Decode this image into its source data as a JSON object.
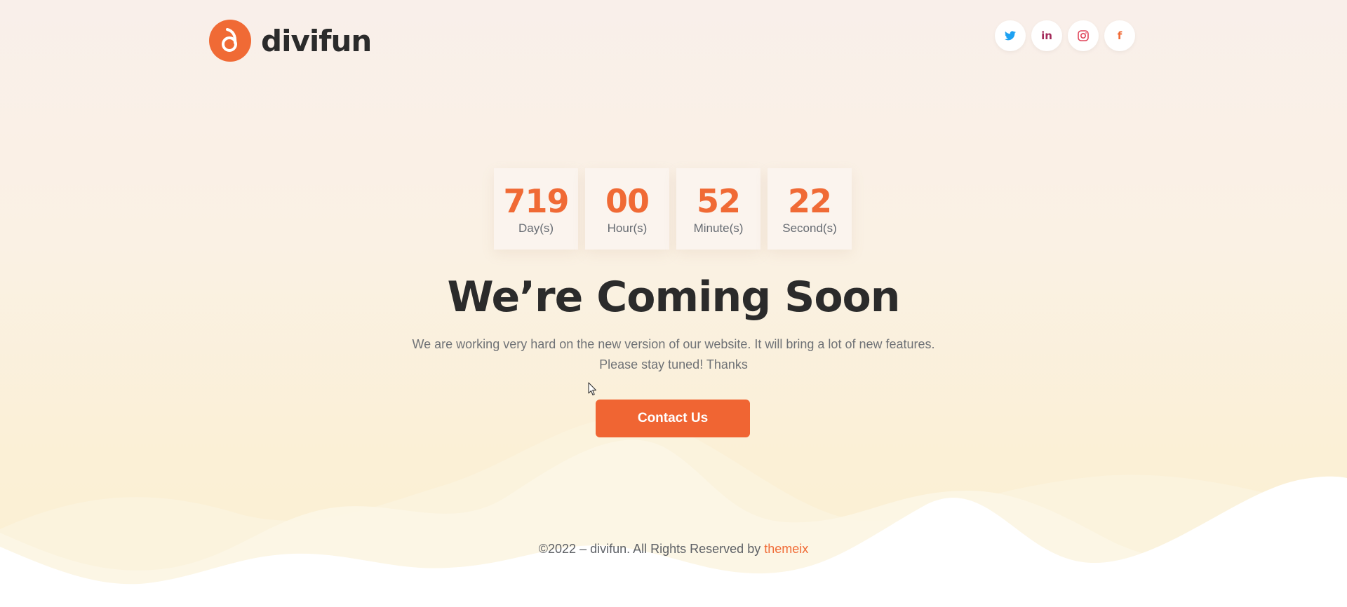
{
  "brand": {
    "name": "divifun",
    "logo_icon": "divifun-logo-icon"
  },
  "social_links": [
    {
      "name": "twitter",
      "icon": "twitter-icon",
      "color": "#1da1f2"
    },
    {
      "name": "linkedin",
      "icon": "linkedin-icon",
      "glyph": "in",
      "color": "#a32a5a"
    },
    {
      "name": "instagram",
      "icon": "instagram-icon",
      "color": "#e0455a"
    },
    {
      "name": "facebook",
      "icon": "facebook-icon",
      "glyph": "f",
      "color": "#f06a35"
    }
  ],
  "countdown": {
    "days": {
      "value": "719",
      "label": "Day(s)"
    },
    "hours": {
      "value": "00",
      "label": "Hour(s)"
    },
    "minutes": {
      "value": "52",
      "label": "Minute(s)"
    },
    "seconds": {
      "value": "22",
      "label": "Second(s)"
    }
  },
  "main": {
    "title": "We’re Coming Soon",
    "subtitle_line1": "We are working very hard on the new version of our website. It will bring a lot of new features.",
    "subtitle_line2": "Please stay tuned! Thanks",
    "contact_button": "Contact Us"
  },
  "footer": {
    "text": "©2022 – divifun. All Rights Reserved by ",
    "link": "themeix"
  },
  "colors": {
    "accent": "#f06a35",
    "heading": "#2b2b2b",
    "body_text": "#6f7276"
  }
}
